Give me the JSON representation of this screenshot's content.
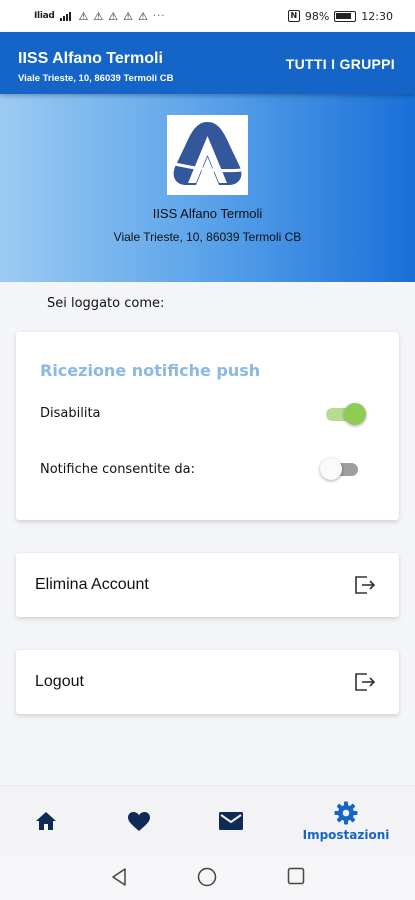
{
  "status_bar": {
    "carrier": "Iliad",
    "battery": "98%",
    "time": "12:30",
    "nfc": "N",
    "notification_icons": [
      "alert-icon",
      "alert-icon",
      "alert-icon",
      "alert-icon",
      "alert-icon"
    ],
    "more": "···"
  },
  "app_bar": {
    "title": "IISS Alfano Termoli",
    "subtitle": "Viale Trieste, 10, 86039 Termoli CB",
    "action": "TUTTI I GRUPPI"
  },
  "hero": {
    "name": "IISS Alfano Termoli",
    "address": "Viale Trieste, 10, 86039 Termoli CB"
  },
  "logged_as": "Sei loggato come:",
  "push_card": {
    "title": "Ricezione notifiche push",
    "rows": [
      {
        "label": "Disabilita",
        "enabled": true
      },
      {
        "label": "Notifiche consentite da:",
        "enabled": false
      }
    ]
  },
  "actions": {
    "delete_account": "Elimina Account",
    "logout": "Logout"
  },
  "bottom_nav": {
    "items": [
      {
        "icon": "home-icon"
      },
      {
        "icon": "heart-icon"
      },
      {
        "icon": "mail-icon"
      },
      {
        "icon": "gear-icon",
        "label": "Impostazioni",
        "active": true
      }
    ]
  },
  "colors": {
    "primary": "#1565c8",
    "card_title": "#8ab8e8",
    "switch_on": "#8fcc54",
    "hero_start": "#9ccbf2",
    "hero_end": "#1a6fd8",
    "icon_dark": "#0f2a55"
  }
}
